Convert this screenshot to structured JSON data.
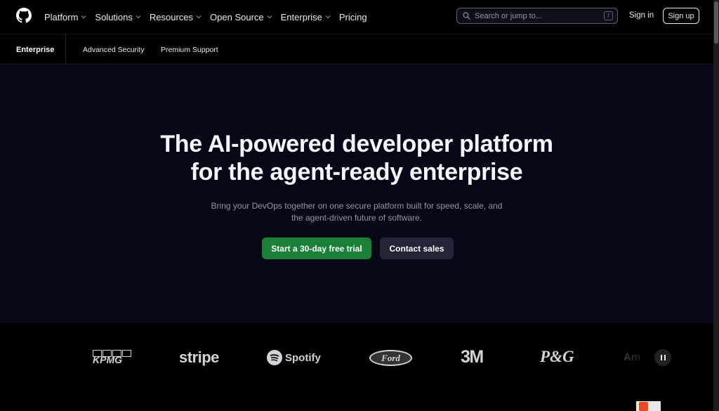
{
  "nav": {
    "items": [
      {
        "label": "Platform",
        "dropdown": true
      },
      {
        "label": "Solutions",
        "dropdown": true
      },
      {
        "label": "Resources",
        "dropdown": true
      },
      {
        "label": "Open Source",
        "dropdown": true
      },
      {
        "label": "Enterprise",
        "dropdown": true
      },
      {
        "label": "Pricing",
        "dropdown": false
      }
    ],
    "search_placeholder": "Search or jump to...",
    "search_shortcut": "/",
    "sign_in": "Sign in",
    "sign_up": "Sign up"
  },
  "subnav": {
    "title": "Enterprise",
    "links": [
      "Advanced Security",
      "Premium Support"
    ]
  },
  "hero": {
    "title_line1": "The AI-powered developer platform",
    "title_line2": "for the agent-ready enterprise",
    "subtitle_line1": "Bring your DevOps together on one secure platform built for speed, scale, and",
    "subtitle_line2": "the agent-driven future of software.",
    "primary_cta": "Start a 30-day free trial",
    "secondary_cta": "Contact sales"
  },
  "logos": {
    "items": [
      "KPMG",
      "stripe",
      "Spotify",
      "Ford",
      "3M",
      "P&G",
      "Am"
    ]
  },
  "colors": {
    "hero_bg": "#060818",
    "primary_button": "#1a7f37",
    "secondary_button": "#212535"
  }
}
